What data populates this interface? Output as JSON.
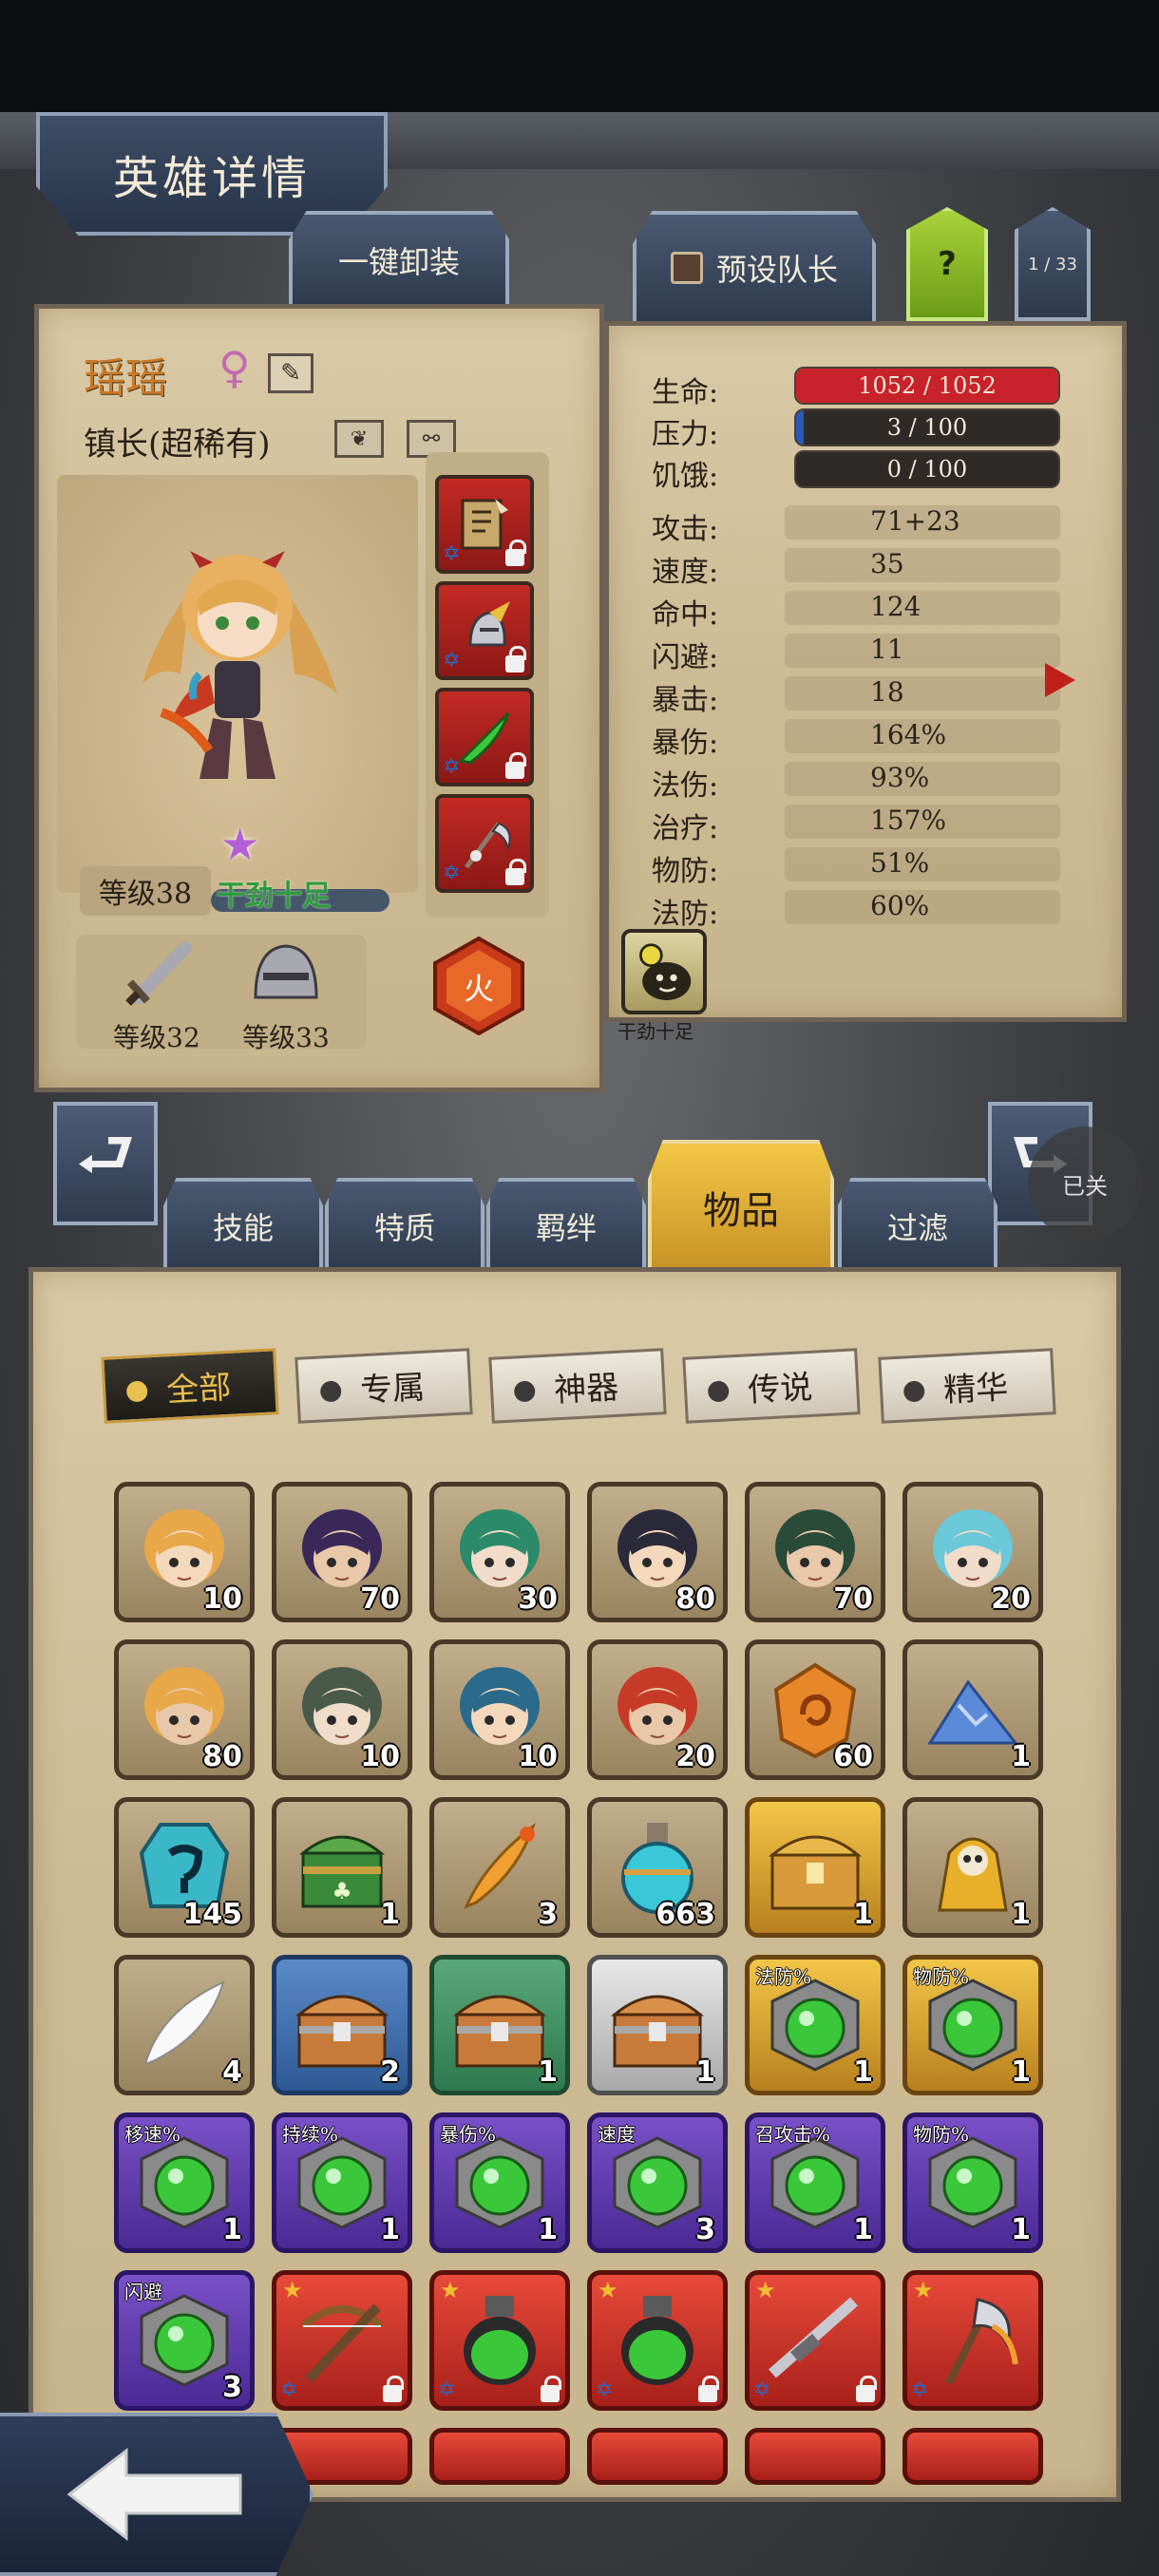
{
  "header": {
    "title": "英雄详情",
    "unequip_all": "一键卸装",
    "preset_leader": "预设队长",
    "help": "?",
    "page_counter": "1 / 33"
  },
  "hero": {
    "name": "瑶瑶",
    "gender_symbol": "♀",
    "role": "镇长(超稀有)",
    "level": "等级38",
    "trait": "干劲十足",
    "weapon_level": "等级32",
    "helmet_level": "等级33",
    "element": "火"
  },
  "stats": {
    "hp": {
      "label": "生命:",
      "current": 1052,
      "max": 1052,
      "text": "1052 / 1052"
    },
    "stress": {
      "label": "压力:",
      "current": 3,
      "max": 100,
      "text": "3 / 100"
    },
    "hunger": {
      "label": "饥饿:",
      "current": 0,
      "max": 100,
      "text": "0 / 100"
    },
    "rows": [
      {
        "label": "攻击:",
        "value": "71+23"
      },
      {
        "label": "速度:",
        "value": "35"
      },
      {
        "label": "命中:",
        "value": "124"
      },
      {
        "label": "闪避:",
        "value": "11"
      },
      {
        "label": "暴击:",
        "value": "18"
      },
      {
        "label": "暴伤:",
        "value": "164%"
      },
      {
        "label": "法伤:",
        "value": "93%"
      },
      {
        "label": "治疗:",
        "value": "157%"
      },
      {
        "label": "物防:",
        "value": "51%"
      },
      {
        "label": "法防:",
        "value": "60%"
      }
    ],
    "ability_label": "干劲十足"
  },
  "tabs": [
    "技能",
    "特质",
    "羁绊",
    "物品",
    "过滤"
  ],
  "active_tab": "物品",
  "toggle_label": "已关",
  "filters": [
    "全部",
    "专属",
    "神器",
    "传说",
    "精华"
  ],
  "colors": {
    "hp": "#c8222a",
    "stress": "#2a5ab8",
    "accent": "#f2c646"
  },
  "inventory": [
    [
      {
        "qty": "10",
        "kind": "hero"
      },
      {
        "qty": "70",
        "kind": "hero"
      },
      {
        "qty": "30",
        "kind": "hero"
      },
      {
        "qty": "80",
        "kind": "hero"
      },
      {
        "qty": "70",
        "kind": "hero"
      },
      {
        "qty": "20",
        "kind": "hero"
      }
    ],
    [
      {
        "qty": "80",
        "kind": "hero"
      },
      {
        "qty": "10",
        "kind": "hero"
      },
      {
        "qty": "10",
        "kind": "hero"
      },
      {
        "qty": "20",
        "kind": "hero"
      },
      {
        "qty": "60",
        "kind": "amber-gem"
      },
      {
        "qty": "1",
        "kind": "crystal-pile"
      }
    ],
    [
      {
        "qty": "145",
        "kind": "rune-stone"
      },
      {
        "qty": "1",
        "kind": "clover-chest"
      },
      {
        "qty": "3",
        "kind": "feather-quill"
      },
      {
        "qty": "663",
        "kind": "potion-flask"
      },
      {
        "qty": "1",
        "kind": "gold-chest"
      },
      {
        "qty": "1",
        "kind": "skull-idol"
      }
    ],
    [
      {
        "qty": "4",
        "kind": "white-feather"
      },
      {
        "qty": "2",
        "kind": "chest"
      },
      {
        "qty": "1",
        "kind": "chest"
      },
      {
        "qty": "1",
        "kind": "chest"
      },
      {
        "qty": "1",
        "kind": "green-orb",
        "tag": "法防%"
      },
      {
        "qty": "1",
        "kind": "green-orb",
        "tag": "物防%"
      }
    ],
    [
      {
        "qty": "1",
        "kind": "green-orb",
        "tag": "移速%"
      },
      {
        "qty": "1",
        "kind": "green-orb",
        "tag": "持续%"
      },
      {
        "qty": "1",
        "kind": "green-orb",
        "tag": "暴伤%"
      },
      {
        "qty": "3",
        "kind": "green-orb",
        "tag": "速度"
      },
      {
        "qty": "1",
        "kind": "green-orb",
        "tag": "召攻击%"
      },
      {
        "qty": "1",
        "kind": "green-orb",
        "tag": "物防%"
      }
    ],
    [
      {
        "qty": "3",
        "kind": "green-orb",
        "tag": "闪避"
      },
      {
        "qty": "",
        "kind": "crossbow"
      },
      {
        "qty": "",
        "kind": "potion-bottle"
      },
      {
        "qty": "",
        "kind": "potion-bottle"
      },
      {
        "qty": "",
        "kind": "rifle"
      },
      {
        "qty": "",
        "kind": "axe"
      }
    ]
  ]
}
